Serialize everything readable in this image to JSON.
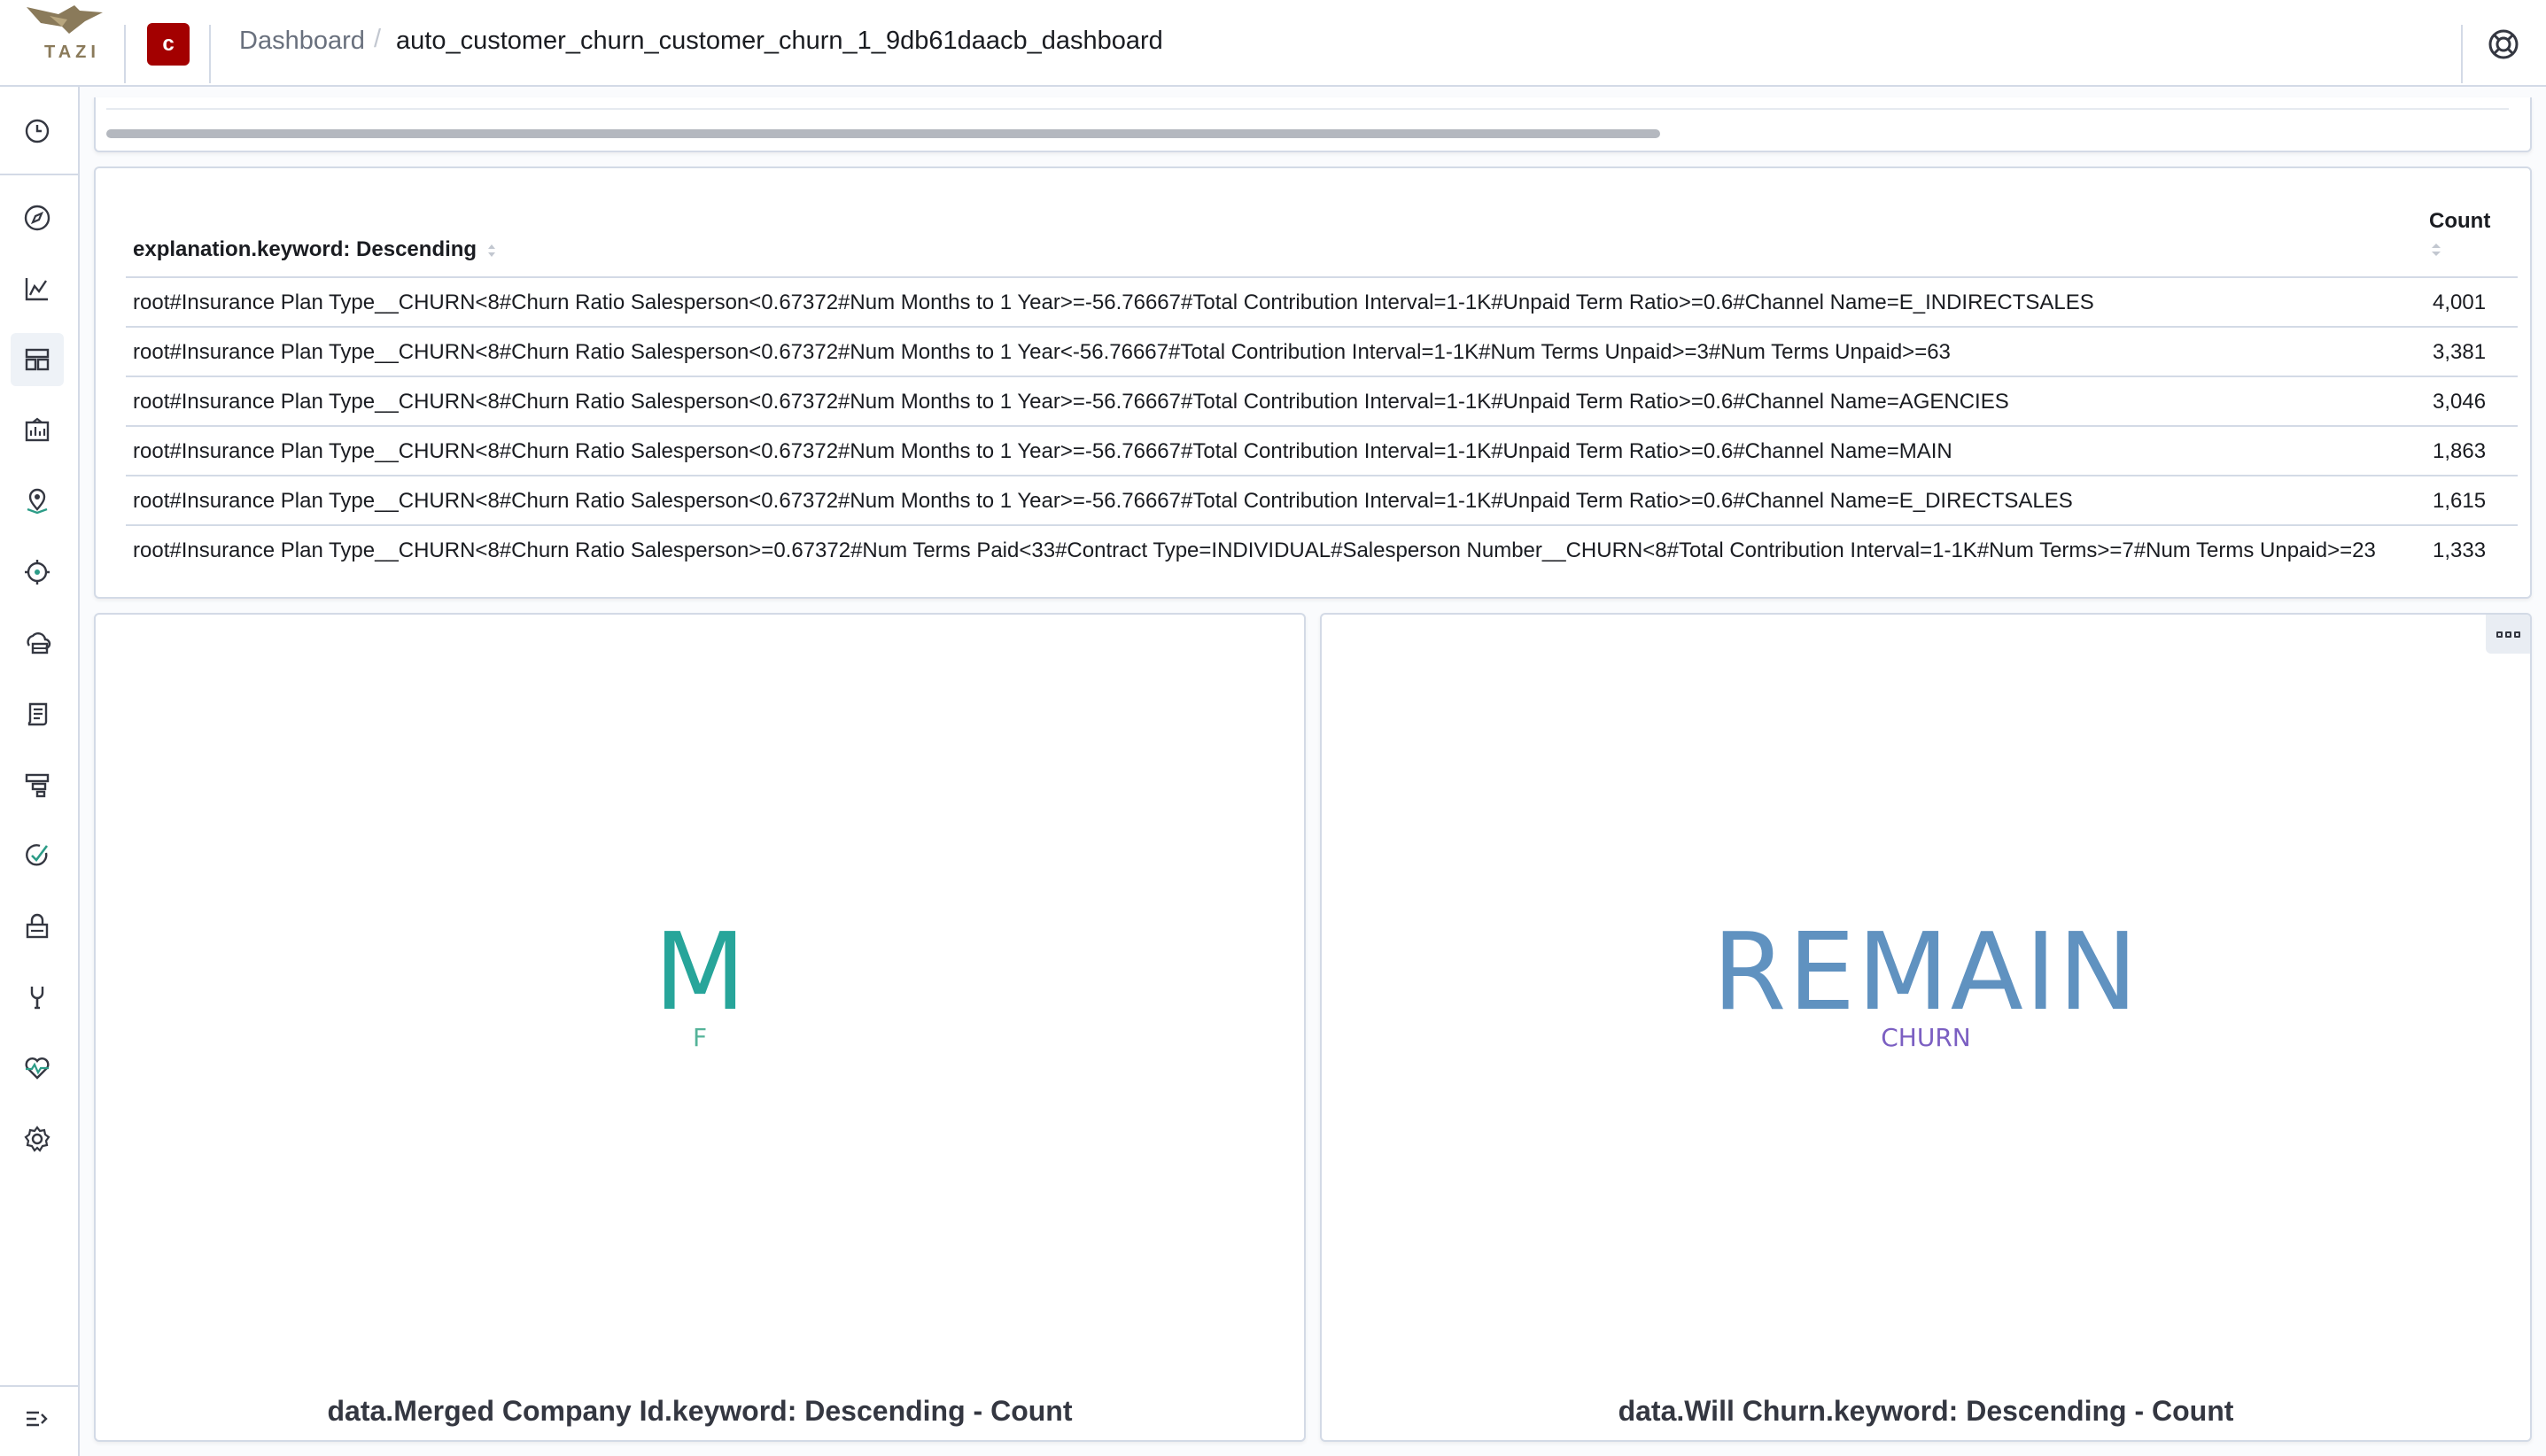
{
  "header": {
    "logo_text": "TAZI",
    "space_initial": "c",
    "breadcrumb_root": "Dashboard",
    "breadcrumb_separator": "/",
    "breadcrumb_current": "auto_customer_churn_customer_churn_1_9db61daacb_dashboard"
  },
  "sidebar": {
    "items": [
      {
        "icon": "clock-icon"
      },
      {
        "icon": "compass-icon"
      },
      {
        "icon": "visualize-icon"
      },
      {
        "icon": "dashboard-icon",
        "active": true
      },
      {
        "icon": "canvas-icon"
      },
      {
        "icon": "maps-icon"
      },
      {
        "icon": "ml-icon"
      },
      {
        "icon": "infrastructure-icon"
      },
      {
        "icon": "logs-icon"
      },
      {
        "icon": "apm-icon"
      },
      {
        "icon": "uptime-icon"
      },
      {
        "icon": "siem-icon"
      },
      {
        "icon": "dev-tools-icon"
      },
      {
        "icon": "monitoring-icon"
      },
      {
        "icon": "settings-icon"
      }
    ],
    "collapse_icon": "collapse-nav-icon"
  },
  "table": {
    "column_explanation": "explanation.keyword: Descending",
    "column_count": "Count",
    "rows": [
      {
        "explanation": "root#Insurance Plan Type__CHURN<8#Churn Ratio Salesperson<0.67372#Num Months to 1 Year>=-56.76667#Total Contribution Interval=1-1K#Unpaid Term Ratio>=0.6#Channel Name=E_INDIRECTSALES",
        "count": "4,001"
      },
      {
        "explanation": "root#Insurance Plan Type__CHURN<8#Churn Ratio Salesperson<0.67372#Num Months to 1 Year<-56.76667#Total Contribution Interval=1-1K#Num Terms Unpaid>=3#Num Terms Unpaid>=63",
        "count": "3,381"
      },
      {
        "explanation": "root#Insurance Plan Type__CHURN<8#Churn Ratio Salesperson<0.67372#Num Months to 1 Year>=-56.76667#Total Contribution Interval=1-1K#Unpaid Term Ratio>=0.6#Channel Name=AGENCIES",
        "count": "3,046"
      },
      {
        "explanation": "root#Insurance Plan Type__CHURN<8#Churn Ratio Salesperson<0.67372#Num Months to 1 Year>=-56.76667#Total Contribution Interval=1-1K#Unpaid Term Ratio>=0.6#Channel Name=MAIN",
        "count": "1,863"
      },
      {
        "explanation": "root#Insurance Plan Type__CHURN<8#Churn Ratio Salesperson<0.67372#Num Months to 1 Year>=-56.76667#Total Contribution Interval=1-1K#Unpaid Term Ratio>=0.6#Channel Name=E_DIRECTSALES",
        "count": "1,615"
      },
      {
        "explanation": "root#Insurance Plan Type__CHURN<8#Churn Ratio Salesperson>=0.67372#Num Terms Paid<33#Contract Type=INDIVIDUAL#Salesperson Number__CHURN<8#Total Contribution Interval=1-1K#Num Terms>=7#Num Terms Unpaid>=23",
        "count": "1,333"
      }
    ]
  },
  "tag_cloud_left": {
    "words": [
      {
        "text": "M",
        "color": "#27a59a"
      },
      {
        "text": "F",
        "color": "#54b399"
      }
    ],
    "caption": "data.Merged Company Id.keyword: Descending - Count"
  },
  "tag_cloud_right": {
    "words": [
      {
        "text": "REMAIN",
        "color": "#6092c0"
      },
      {
        "text": "CHURN",
        "color": "#7b5fc2"
      }
    ],
    "caption": "data.Will Churn.keyword: Descending - Count"
  },
  "colors": {
    "brand_red": "#a30000",
    "border": "#d3dae6"
  }
}
